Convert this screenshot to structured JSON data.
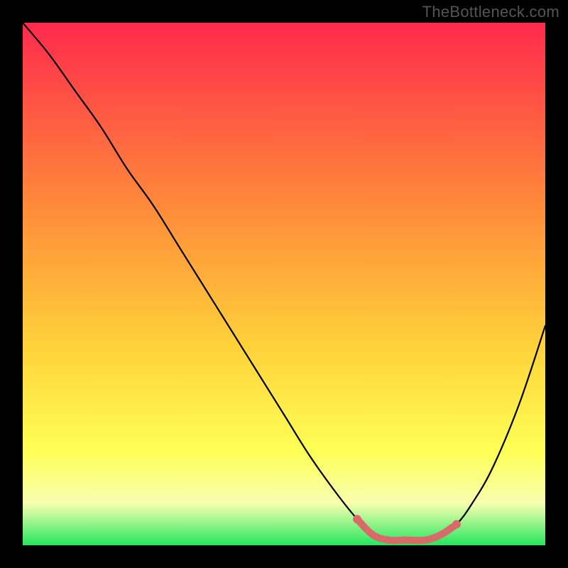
{
  "watermark": "TheBottleneck.com",
  "colors": {
    "page_bg": "#000000",
    "curve": "#000000",
    "highlight": "#d86a6a",
    "gradient_stops": [
      {
        "offset": "0%",
        "color": "#ff2a4d"
      },
      {
        "offset": "35%",
        "color": "#ff8a3a"
      },
      {
        "offset": "62%",
        "color": "#ffd23a"
      },
      {
        "offset": "82%",
        "color": "#ffff55"
      },
      {
        "offset": "92%",
        "color": "#f7ffb0"
      },
      {
        "offset": "100%",
        "color": "#27e65f"
      }
    ]
  },
  "chart_data": {
    "type": "line",
    "title": "",
    "xlabel": "",
    "ylabel": "",
    "xlim": [
      0,
      100
    ],
    "ylim": [
      0,
      100
    ],
    "x": [
      0,
      5,
      10,
      15,
      20,
      25,
      30,
      35,
      40,
      45,
      50,
      55,
      60,
      64,
      67,
      70,
      73,
      77,
      80,
      83,
      86,
      90,
      95,
      100
    ],
    "values": [
      100,
      94,
      87,
      80,
      72,
      65,
      57,
      49,
      41,
      33,
      25,
      17,
      10,
      5,
      2,
      1,
      1,
      1,
      2,
      4,
      8,
      15,
      27,
      42
    ],
    "highlight_range": {
      "x_start": 64,
      "x_end": 83
    },
    "grid": false,
    "legend": null
  }
}
